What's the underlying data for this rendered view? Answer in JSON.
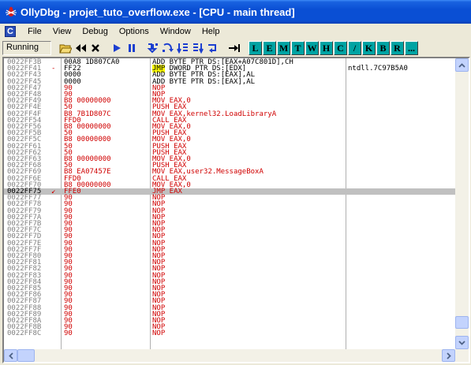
{
  "window": {
    "title": "OllyDbg - projet_tuto_overflow.exe - [CPU - main thread]"
  },
  "menu": {
    "mdi_icon": "C",
    "items": [
      "File",
      "View",
      "Debug",
      "Options",
      "Window",
      "Help"
    ]
  },
  "toolbar": {
    "status": "Running",
    "buttons": [
      "open-icon",
      "rewind-icon",
      "close-icon",
      "run-icon",
      "pause-icon",
      "step-into-icon",
      "step-over-icon",
      "trace-into-icon",
      "trace-over-icon",
      "execute-till-return-icon",
      "goto-icon"
    ],
    "letters": [
      "L",
      "E",
      "M",
      "T",
      "W",
      "H",
      "C",
      "/",
      "K",
      "B",
      "R",
      "..."
    ]
  },
  "colors": {
    "titlebar": "#0a4fd4",
    "opcode_red": "#d00000",
    "toolbar_letter_bg": "#00a3a3",
    "selected_row": "#c0c0c0",
    "jmp_highlight": "#ffff00"
  },
  "disasm": {
    "rows": [
      {
        "addr": "0022FF3B",
        "arrow": "",
        "hex": "00A8 1D807CA0",
        "asm": "ADD BYTE PTR DS:[EAX+A07C801D],CH",
        "cmt": "",
        "hex_red": false,
        "asm_red": false
      },
      {
        "addr": "0022FF41",
        "arrow": "-",
        "hex": "FF22",
        "asm_hl": "JMP",
        "asm": " DWORD PTR DS:[EDX]",
        "cmt": "ntdll.7C97B5A0",
        "hex_red": false,
        "asm_red": false
      },
      {
        "addr": "0022FF43",
        "arrow": "",
        "hex": "0000",
        "asm": "ADD BYTE PTR DS:[EAX],AL",
        "cmt": "",
        "hex_red": false,
        "asm_red": false
      },
      {
        "addr": "0022FF45",
        "arrow": "",
        "hex": "0000",
        "asm": "ADD BYTE PTR DS:[EAX],AL",
        "cmt": "",
        "hex_red": false,
        "asm_red": false
      },
      {
        "addr": "0022FF47",
        "arrow": "",
        "hex": "90",
        "asm": "NOP",
        "cmt": "",
        "hex_red": true,
        "asm_red": true
      },
      {
        "addr": "0022FF48",
        "arrow": "",
        "hex": "90",
        "asm": "NOP",
        "cmt": "",
        "hex_red": true,
        "asm_red": true
      },
      {
        "addr": "0022FF49",
        "arrow": "",
        "hex": "B8 00000000",
        "asm": "MOV EAX,0",
        "cmt": "",
        "hex_red": true,
        "asm_red": true
      },
      {
        "addr": "0022FF4E",
        "arrow": "",
        "hex": "50",
        "asm": "PUSH EAX",
        "cmt": "",
        "hex_red": true,
        "asm_red": true
      },
      {
        "addr": "0022FF4F",
        "arrow": "",
        "hex": "B8 7B1D807C",
        "asm": "MOV EAX,kernel32.LoadLibraryA",
        "cmt": "",
        "hex_red": true,
        "asm_red": true
      },
      {
        "addr": "0022FF54",
        "arrow": "",
        "hex": "FFD0",
        "asm": "CALL EAX",
        "cmt": "",
        "hex_red": true,
        "asm_red": true
      },
      {
        "addr": "0022FF56",
        "arrow": "",
        "hex": "B8 00000000",
        "asm": "MOV EAX,0",
        "cmt": "",
        "hex_red": true,
        "asm_red": true
      },
      {
        "addr": "0022FF5B",
        "arrow": "",
        "hex": "50",
        "asm": "PUSH EAX",
        "cmt": "",
        "hex_red": true,
        "asm_red": true
      },
      {
        "addr": "0022FF5C",
        "arrow": "",
        "hex": "B8 00000000",
        "asm": "MOV EAX,0",
        "cmt": "",
        "hex_red": true,
        "asm_red": true
      },
      {
        "addr": "0022FF61",
        "arrow": "",
        "hex": "50",
        "asm": "PUSH EAX",
        "cmt": "",
        "hex_red": true,
        "asm_red": true
      },
      {
        "addr": "0022FF62",
        "arrow": "",
        "hex": "50",
        "asm": "PUSH EAX",
        "cmt": "",
        "hex_red": true,
        "asm_red": true
      },
      {
        "addr": "0022FF63",
        "arrow": "",
        "hex": "B8 00000000",
        "asm": "MOV EAX,0",
        "cmt": "",
        "hex_red": true,
        "asm_red": true
      },
      {
        "addr": "0022FF68",
        "arrow": "",
        "hex": "50",
        "asm": "PUSH EAX",
        "cmt": "",
        "hex_red": true,
        "asm_red": true
      },
      {
        "addr": "0022FF69",
        "arrow": "",
        "hex": "B8 EA07457E",
        "asm": "MOV EAX,user32.MessageBoxA",
        "cmt": "",
        "hex_red": true,
        "asm_red": true
      },
      {
        "addr": "0022FF6E",
        "arrow": "",
        "hex": "FFD0",
        "asm": "CALL EAX",
        "cmt": "",
        "hex_red": true,
        "asm_red": true
      },
      {
        "addr": "0022FF70",
        "arrow": "",
        "hex": "B8 00000000",
        "asm": "MOV EAX,0",
        "cmt": "",
        "hex_red": true,
        "asm_red": true
      },
      {
        "addr": "0022FF75",
        "arrow": "↙",
        "hex": "FFE0",
        "asm": "JMP EAX",
        "cmt": "",
        "hex_red": true,
        "asm_red": true,
        "selected": true
      },
      {
        "addr": "0022FF77",
        "arrow": "",
        "hex": "90",
        "asm": "NOP",
        "cmt": "",
        "hex_red": true,
        "asm_red": true
      },
      {
        "addr": "0022FF78",
        "arrow": "",
        "hex": "90",
        "asm": "NOP",
        "cmt": "",
        "hex_red": true,
        "asm_red": true
      },
      {
        "addr": "0022FF79",
        "arrow": "",
        "hex": "90",
        "asm": "NOP",
        "cmt": "",
        "hex_red": true,
        "asm_red": true
      },
      {
        "addr": "0022FF7A",
        "arrow": "",
        "hex": "90",
        "asm": "NOP",
        "cmt": "",
        "hex_red": true,
        "asm_red": true
      },
      {
        "addr": "0022FF7B",
        "arrow": "",
        "hex": "90",
        "asm": "NOP",
        "cmt": "",
        "hex_red": true,
        "asm_red": true
      },
      {
        "addr": "0022FF7C",
        "arrow": "",
        "hex": "90",
        "asm": "NOP",
        "cmt": "",
        "hex_red": true,
        "asm_red": true
      },
      {
        "addr": "0022FF7D",
        "arrow": "",
        "hex": "90",
        "asm": "NOP",
        "cmt": "",
        "hex_red": true,
        "asm_red": true
      },
      {
        "addr": "0022FF7E",
        "arrow": "",
        "hex": "90",
        "asm": "NOP",
        "cmt": "",
        "hex_red": true,
        "asm_red": true
      },
      {
        "addr": "0022FF7F",
        "arrow": "",
        "hex": "90",
        "asm": "NOP",
        "cmt": "",
        "hex_red": true,
        "asm_red": true
      },
      {
        "addr": "0022FF80",
        "arrow": "",
        "hex": "90",
        "asm": "NOP",
        "cmt": "",
        "hex_red": true,
        "asm_red": true
      },
      {
        "addr": "0022FF81",
        "arrow": "",
        "hex": "90",
        "asm": "NOP",
        "cmt": "",
        "hex_red": true,
        "asm_red": true
      },
      {
        "addr": "0022FF82",
        "arrow": "",
        "hex": "90",
        "asm": "NOP",
        "cmt": "",
        "hex_red": true,
        "asm_red": true
      },
      {
        "addr": "0022FF83",
        "arrow": "",
        "hex": "90",
        "asm": "NOP",
        "cmt": "",
        "hex_red": true,
        "asm_red": true
      },
      {
        "addr": "0022FF84",
        "arrow": "",
        "hex": "90",
        "asm": "NOP",
        "cmt": "",
        "hex_red": true,
        "asm_red": true
      },
      {
        "addr": "0022FF85",
        "arrow": "",
        "hex": "90",
        "asm": "NOP",
        "cmt": "",
        "hex_red": true,
        "asm_red": true
      },
      {
        "addr": "0022FF86",
        "arrow": "",
        "hex": "90",
        "asm": "NOP",
        "cmt": "",
        "hex_red": true,
        "asm_red": true
      },
      {
        "addr": "0022FF87",
        "arrow": "",
        "hex": "90",
        "asm": "NOP",
        "cmt": "",
        "hex_red": true,
        "asm_red": true
      },
      {
        "addr": "0022FF88",
        "arrow": "",
        "hex": "90",
        "asm": "NOP",
        "cmt": "",
        "hex_red": true,
        "asm_red": true
      },
      {
        "addr": "0022FF89",
        "arrow": "",
        "hex": "90",
        "asm": "NOP",
        "cmt": "",
        "hex_red": true,
        "asm_red": true
      },
      {
        "addr": "0022FF8A",
        "arrow": "",
        "hex": "90",
        "asm": "NOP",
        "cmt": "",
        "hex_red": true,
        "asm_red": true
      },
      {
        "addr": "0022FF8B",
        "arrow": "",
        "hex": "90",
        "asm": "NOP",
        "cmt": "",
        "hex_red": true,
        "asm_red": true
      },
      {
        "addr": "0022FF8C",
        "arrow": "",
        "hex": "90",
        "asm": "NOP",
        "cmt": "",
        "hex_red": true,
        "asm_red": true
      }
    ]
  }
}
